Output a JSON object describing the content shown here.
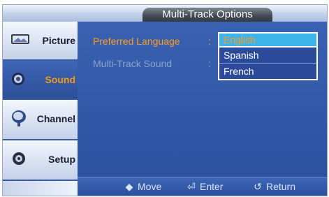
{
  "window": {
    "title": "Multi-Track Options"
  },
  "sidebar": {
    "items": [
      {
        "label": "Picture",
        "icon": "picture-icon",
        "active": false
      },
      {
        "label": "Sound",
        "icon": "sound-icon",
        "active": true
      },
      {
        "label": "Channel",
        "icon": "channel-icon",
        "active": false
      },
      {
        "label": "Setup",
        "icon": "setup-icon",
        "active": false
      }
    ]
  },
  "settings": [
    {
      "label": "Preferred Language",
      "separator": ":",
      "value": "English",
      "active": true
    },
    {
      "label": "Multi-Track Sound",
      "separator": ":",
      "active": false
    }
  ],
  "dropdown": {
    "selected": "English",
    "options": [
      "Spanish",
      "French"
    ]
  },
  "footer": {
    "move": {
      "icon": "move-icon",
      "label": "Move"
    },
    "enter": {
      "icon": "enter-icon",
      "label": "Enter"
    },
    "return": {
      "icon": "return-icon",
      "label": "Return"
    }
  },
  "colors": {
    "accent_orange": "#ff9b1a",
    "panel_blue": "#2f57a3",
    "highlight_cyan": "#3fb4e8"
  }
}
